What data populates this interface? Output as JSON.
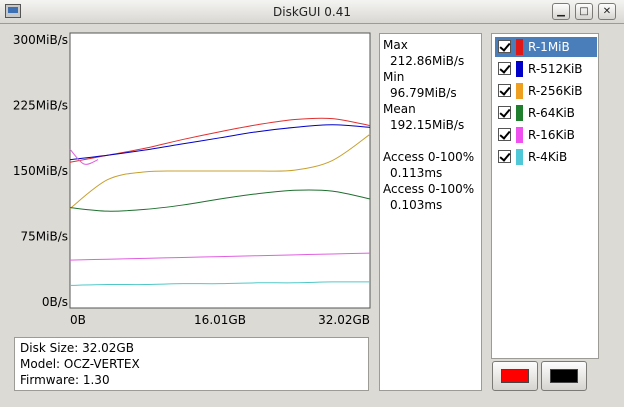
{
  "window": {
    "title": "DiskGUI  0.41",
    "minimize_glyph": "▁",
    "maximize_glyph": "□",
    "close_glyph": "✕"
  },
  "chart_data": {
    "type": "line",
    "xlabel": "",
    "ylabel": "",
    "x_ticks": [
      "0B",
      "16.01GB",
      "32.02GB"
    ],
    "xlim": [
      0,
      32.02
    ],
    "x_unit": "GB",
    "y_ticks": [
      "300MiB/s",
      "225MiB/s",
      "150MiB/s",
      "75MiB/s",
      "0B/s"
    ],
    "ylim": [
      0,
      300
    ],
    "y_unit": "MiB/s",
    "grid": false,
    "series": [
      {
        "name": "R-1MiB",
        "color": "#e03030",
        "x": [
          0,
          4,
          8,
          12,
          16,
          20,
          24,
          28,
          32.02
        ],
        "values": [
          160,
          168,
          176,
          186,
          195,
          203,
          209,
          210,
          202
        ]
      },
      {
        "name": "R-512KiB",
        "color": "#0000c8",
        "x": [
          0,
          4,
          8,
          12,
          16,
          20,
          24,
          28,
          32.02
        ],
        "values": [
          163,
          168,
          174,
          181,
          188,
          195,
          200,
          203,
          200
        ]
      },
      {
        "name": "R-256KiB",
        "color": "#c8a030",
        "x": [
          0,
          4,
          8,
          12,
          16,
          20,
          24,
          28,
          32.02
        ],
        "values": [
          107,
          140,
          149,
          150,
          150,
          150,
          151,
          162,
          192
        ]
      },
      {
        "name": "R-64KiB",
        "color": "#1f6f2f",
        "x": [
          0,
          4,
          8,
          12,
          16,
          20,
          24,
          28,
          32.02
        ],
        "values": [
          108,
          104,
          106,
          111,
          118,
          124,
          128,
          127,
          118
        ]
      },
      {
        "name": "R-16KiB",
        "color": "#e060e0",
        "x": [
          0,
          4,
          8,
          12,
          16,
          20,
          24,
          28,
          32.02
        ],
        "values": [
          48,
          49,
          50,
          51,
          52,
          53,
          54,
          55,
          56
        ]
      },
      {
        "name": "R-4KiB",
        "color": "#50c8c8",
        "x": [
          0,
          4,
          8,
          12,
          16,
          20,
          24,
          28,
          32.02
        ],
        "values": [
          19,
          20,
          20,
          21,
          21,
          22,
          22,
          23,
          23
        ]
      }
    ],
    "extra_series": [
      {
        "color": "#e060e0",
        "x": [
          0,
          1.5,
          3
        ],
        "values": [
          175,
          158,
          163
        ]
      }
    ]
  },
  "stats": {
    "max_label": "Max",
    "max_value": "212.86MiB/s",
    "min_label": "Min",
    "min_value": "96.79MiB/s",
    "mean_label": "Mean",
    "mean_value": "192.15MiB/s",
    "access1_label": "Access 0-100%",
    "access1_value": "0.113ms",
    "access2_label": "Access 0-100%",
    "access2_value": "0.103ms"
  },
  "series_list": [
    {
      "label": "R-1MiB",
      "color": "#e01818",
      "checked": true,
      "selected": true
    },
    {
      "label": "R-512KiB",
      "color": "#0000c8",
      "checked": true,
      "selected": false
    },
    {
      "label": "R-256KiB",
      "color": "#f0a020",
      "checked": true,
      "selected": false
    },
    {
      "label": "R-64KiB",
      "color": "#1f7f2f",
      "checked": true,
      "selected": false
    },
    {
      "label": "R-16KiB",
      "color": "#f050f0",
      "checked": true,
      "selected": false
    },
    {
      "label": "R-4KiB",
      "color": "#50c8d8",
      "checked": true,
      "selected": false
    }
  ],
  "disk_info": {
    "size": "Disk Size: 32.02GB",
    "model": "Model: OCZ-VERTEX",
    "firmware": "Firmware: 1.30"
  },
  "color_buttons": {
    "line_color": "#ff0000",
    "bg_color": "#000000"
  }
}
